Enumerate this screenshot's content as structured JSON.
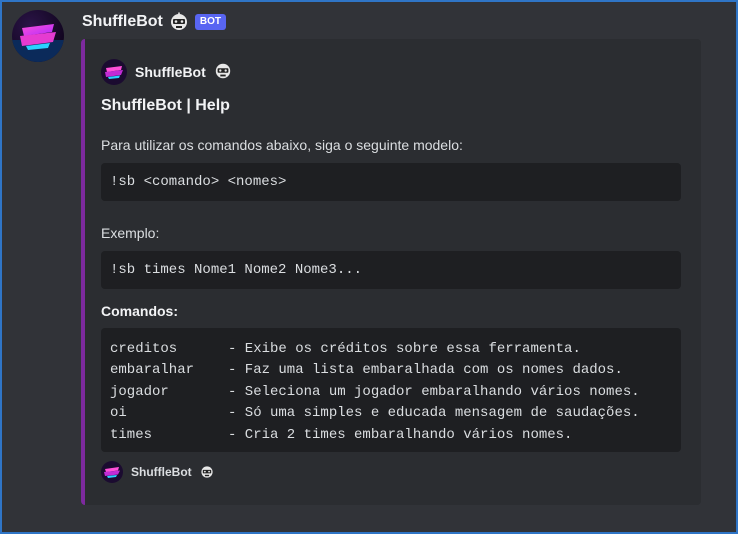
{
  "message": {
    "username": "ShuffleBot",
    "bot_tag": "BOT",
    "avatar_icon": "shufflebot-logo-icon",
    "robot_icon": "robot-face-icon"
  },
  "embed": {
    "accent_color": "#7d2a9e",
    "author": "ShuffleBot",
    "title": "ShuffleBot | Help",
    "intro": "Para utilizar os comandos abaixo, siga o seguinte modelo:",
    "usage_code": "!sb <comando> <nomes>",
    "example_label": "Exemplo:",
    "example_code": "!sb times Nome1 Nome2 Nome3...",
    "commands_label": "Comandos:",
    "commands": [
      {
        "name": "creditos",
        "desc": "- Exibe os créditos sobre essa ferramenta."
      },
      {
        "name": "embaralhar",
        "desc": "- Faz uma lista embaralhada com os nomes dados."
      },
      {
        "name": "jogador",
        "desc": "- Seleciona um jogador embaralhando vários nomes."
      },
      {
        "name": "oi",
        "desc": "- Só uma simples e educada mensagem de saudações."
      },
      {
        "name": "times",
        "desc": "- Cria 2 times embaralhando vários nomes."
      }
    ],
    "footer": "ShuffleBot"
  }
}
